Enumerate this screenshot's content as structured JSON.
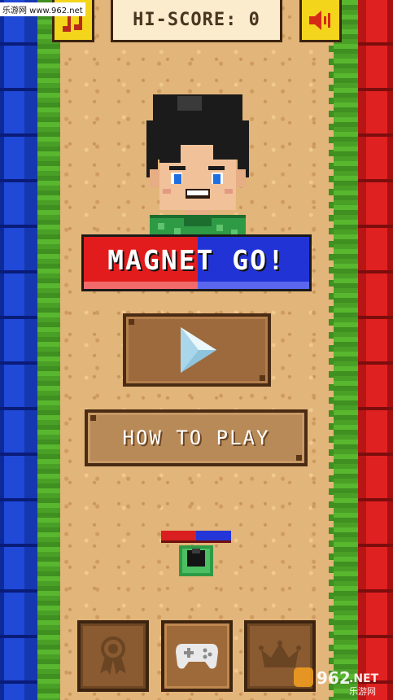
{
  "watermark": {
    "top_left": "乐游网 www.962.net",
    "bottom_right_brand": "962",
    "bottom_right_suffix": ".NET",
    "bottom_right_cn": "乐游网"
  },
  "header": {
    "hiscore_label": "HI-SCORE: 0",
    "music_icon": "music-note-icon",
    "sound_icon": "speaker-icon",
    "button_color": "#f3d51c"
  },
  "logo": {
    "title": "MAGNET GO!",
    "red": "#e21c1c",
    "blue": "#2233d6"
  },
  "menu": {
    "play_icon": "play-icon",
    "howto_label": "HOW TO PLAY"
  },
  "bottom_bar": {
    "icons": [
      "ribbon-award-icon",
      "gamepad-icon",
      "crown-icon"
    ]
  },
  "walls": {
    "left": "#1f49d6",
    "right": "#e02121",
    "grass": "#4aa026",
    "sand": "#e2b57a"
  }
}
